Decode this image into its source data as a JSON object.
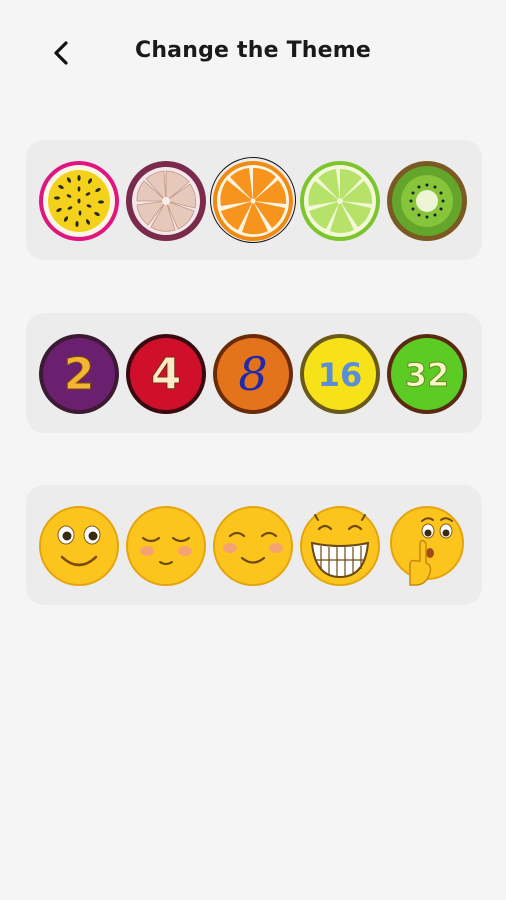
{
  "header": {
    "title": "Change the Theme",
    "back_icon": "chevron-left-icon"
  },
  "themes": [
    {
      "id": "fruit",
      "selected": false,
      "icons": [
        "passion-fruit-icon",
        "mangosteen-icon",
        "orange-slice-icon",
        "lime-slice-icon",
        "kiwi-slice-icon"
      ]
    },
    {
      "id": "number",
      "selected": false,
      "tiles": [
        {
          "label": "2",
          "bg": "#6b1f6f",
          "text": "#f2b632"
        },
        {
          "label": "4",
          "bg": "#d0102a",
          "text": "#ffe9c6"
        },
        {
          "label": "8",
          "bg": "#e5731c",
          "text": "#1f2aa8"
        },
        {
          "label": "16",
          "bg": "#f7e21a",
          "text": "#5a8ed8"
        },
        {
          "label": "32",
          "bg": "#5ccb24",
          "text": "#f6f6c8"
        }
      ]
    },
    {
      "id": "emoji",
      "selected": false,
      "icons": [
        "smiling-face-icon",
        "shy-face-icon",
        "content-face-icon",
        "grinning-face-icon",
        "shushing-face-icon"
      ]
    }
  ],
  "colors": {
    "background": "#f5f5f5",
    "card": "#ececec",
    "emoji_yellow": "#fcc51d",
    "ring_selected": "#111111"
  }
}
